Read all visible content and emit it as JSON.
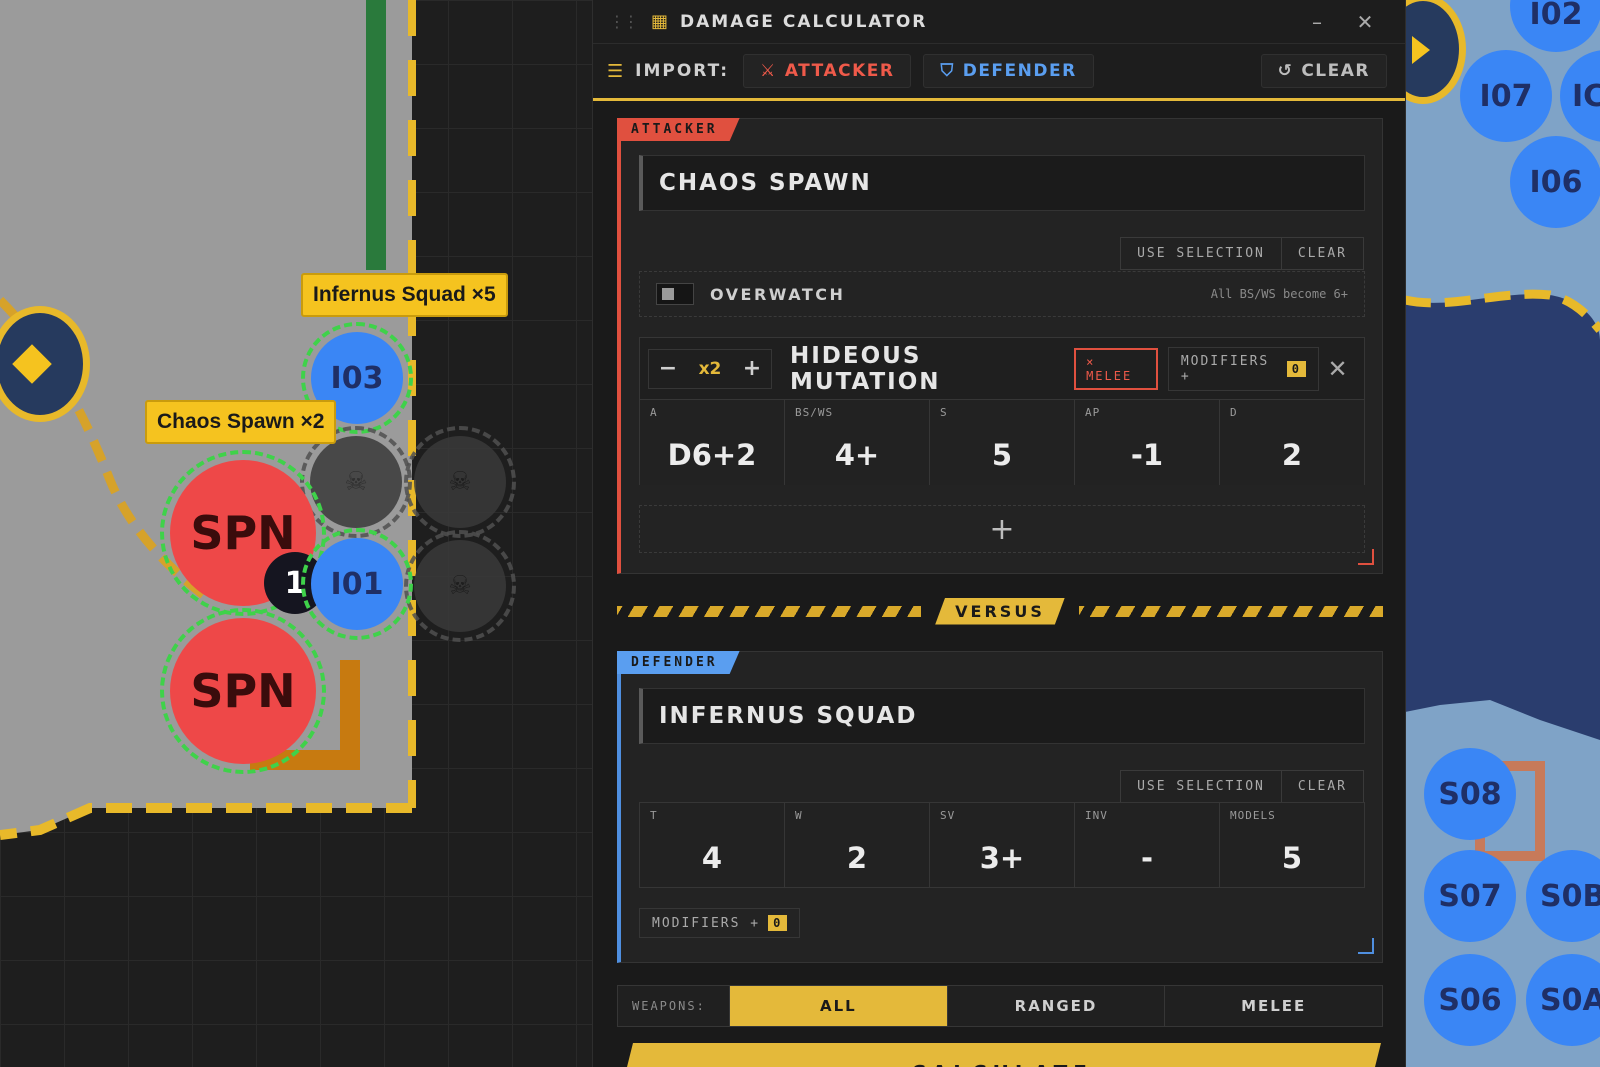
{
  "map": {
    "labels": {
      "infernus": "Infernus Squad ×5",
      "chaos": "Chaos Spawn ×2"
    },
    "tokens": {
      "i03": "I03",
      "i01": "I01",
      "spn1": "SPN",
      "spn2": "SPN",
      "i02": "I02",
      "i07": "I07",
      "i06": "I06",
      "s08": "S08",
      "s07": "S07",
      "s06": "S06",
      "s0b_partial": "S0B",
      "s0a_partial": "S0A",
      "i0_partial": "IC"
    },
    "badge": "1",
    "icons": {
      "objective": "diamond-icon",
      "skull": "skull-icon",
      "play": "play-icon"
    },
    "colors": {
      "accent": "#f5c31f",
      "friendly": "#3a86f5",
      "enemy": "#ee4848",
      "select_ring": "#3fd24a"
    }
  },
  "panel": {
    "title": "DAMAGE CALCULATOR",
    "import": {
      "label": "IMPORT:",
      "attacker": "ATTACKER",
      "defender": "DEFENDER",
      "clear": "CLEAR"
    },
    "attacker": {
      "tag": "ATTACKER",
      "unit_name": "CHAOS SPAWN",
      "use_selection": "USE SELECTION",
      "clear": "CLEAR",
      "overwatch": {
        "label": "OVERWATCH",
        "hint": "All BS/WS become 6+"
      },
      "weapon": {
        "count": "x2",
        "name": "HIDEOUS MUTATION",
        "type": "× MELEE",
        "modifiers_label": "MODIFIERS +",
        "modifiers_count": "0",
        "stats": [
          {
            "label": "A",
            "value": "D6+2"
          },
          {
            "label": "BS/WS",
            "value": "4+"
          },
          {
            "label": "S",
            "value": "5"
          },
          {
            "label": "AP",
            "value": "-1"
          },
          {
            "label": "D",
            "value": "2"
          }
        ]
      },
      "add": "+"
    },
    "versus": "VERSUS",
    "defender": {
      "tag": "DEFENDER",
      "unit_name": "INFERNUS SQUAD",
      "use_selection": "USE SELECTION",
      "clear": "CLEAR",
      "stats": [
        {
          "label": "T",
          "value": "4"
        },
        {
          "label": "W",
          "value": "2"
        },
        {
          "label": "SV",
          "value": "3+"
        },
        {
          "label": "INV",
          "value": "-"
        },
        {
          "label": "MODELS",
          "value": "5"
        }
      ],
      "modifiers_label": "MODIFIERS +",
      "modifiers_count": "0"
    },
    "weapons_filter": {
      "label": "WEAPONS:",
      "options": [
        "ALL",
        "RANGED",
        "MELEE"
      ],
      "selected": "ALL"
    },
    "calculate": "CALCULATE",
    "colors": {
      "accent": "#e4b93a",
      "attacker": "#e0503f",
      "defender": "#4f8fe0"
    }
  }
}
